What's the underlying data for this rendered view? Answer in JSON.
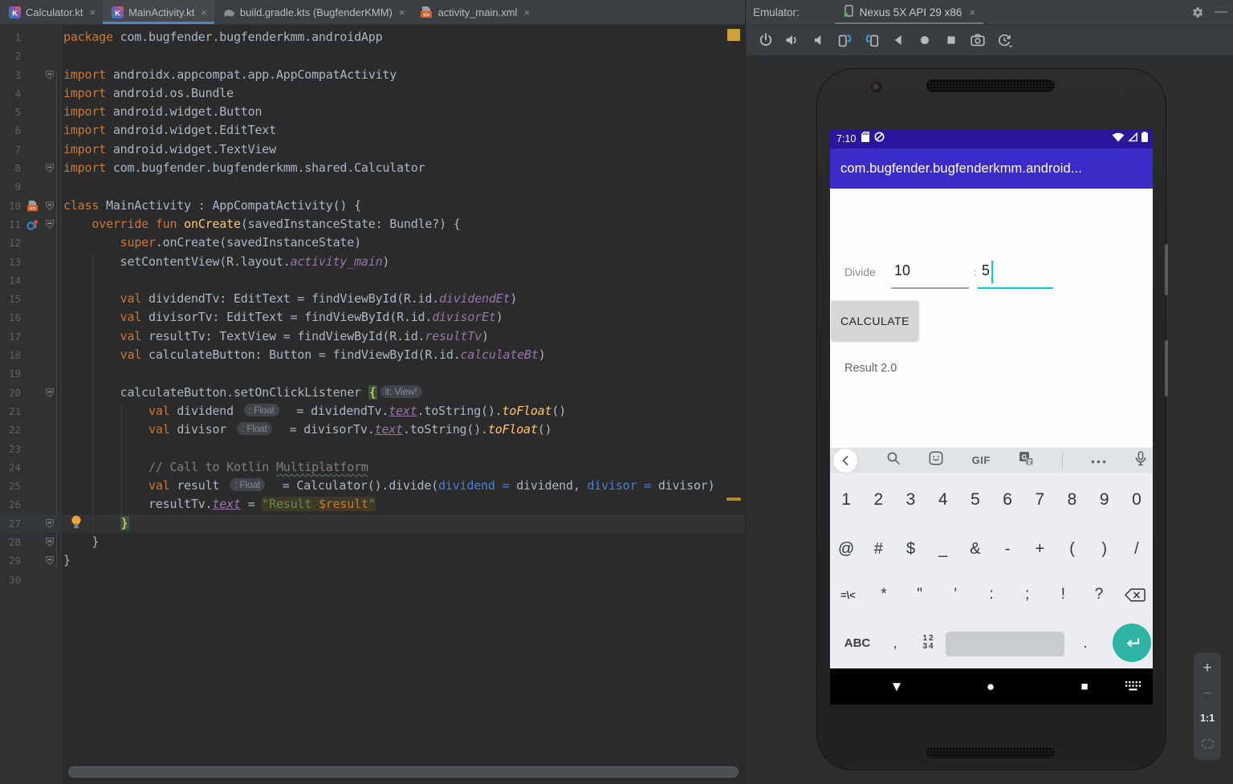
{
  "colors": {
    "accent_teal": "#00d3cb",
    "app_bar": "#3b2bc9",
    "status_bar": "#2a169c",
    "enter_key": "#2fb3a5",
    "tab_underline": "#4a88c7",
    "warning_stripe": "#d0a13a"
  },
  "ide": {
    "tabs": [
      {
        "label": "Calculator.kt",
        "icon": "kotlin",
        "active": false,
        "close": "×"
      },
      {
        "label": "MainActivity.kt",
        "icon": "kotlin",
        "active": true,
        "close": "×"
      },
      {
        "label": "build.gradle.kts (BugfenderKMM)",
        "icon": "gradle",
        "active": false,
        "close": "×"
      },
      {
        "label": "activity_main.xml",
        "icon": "xml",
        "active": false,
        "close": "×"
      }
    ],
    "editor": {
      "lines": [
        {
          "n": 1,
          "fold": "",
          "icon": "",
          "t": [
            [
              "k",
              "package"
            ],
            [
              "d",
              " com.bugfender.bugfenderkmm.androidApp"
            ]
          ]
        },
        {
          "n": 2,
          "fold": "",
          "icon": "",
          "t": []
        },
        {
          "n": 3,
          "fold": "start",
          "icon": "",
          "t": [
            [
              "k",
              "import"
            ],
            [
              "d",
              " androidx.appcompat.app.AppCompatActivity"
            ]
          ]
        },
        {
          "n": 4,
          "fold": "",
          "icon": "",
          "t": [
            [
              "k",
              "import"
            ],
            [
              "d",
              " android.os.Bundle"
            ]
          ]
        },
        {
          "n": 5,
          "fold": "",
          "icon": "",
          "t": [
            [
              "k",
              "import"
            ],
            [
              "d",
              " android.widget.Button"
            ]
          ]
        },
        {
          "n": 6,
          "fold": "",
          "icon": "",
          "t": [
            [
              "k",
              "import"
            ],
            [
              "d",
              " android.widget.EditText"
            ]
          ]
        },
        {
          "n": 7,
          "fold": "",
          "icon": "",
          "t": [
            [
              "k",
              "import"
            ],
            [
              "d",
              " android.widget.TextView"
            ]
          ]
        },
        {
          "n": 8,
          "fold": "end",
          "icon": "",
          "t": [
            [
              "k",
              "import"
            ],
            [
              "d",
              " com.bugfender.bugfenderkmm.shared.Calculator"
            ]
          ]
        },
        {
          "n": 9,
          "fold": "",
          "icon": "",
          "t": []
        },
        {
          "n": 10,
          "fold": "start",
          "icon": "layout",
          "t": [
            [
              "k",
              "class"
            ],
            [
              "d",
              " MainActivity : AppCompatActivity() {"
            ]
          ]
        },
        {
          "n": 11,
          "fold": "start",
          "icon": "override",
          "t": [
            [
              "d",
              "    "
            ],
            [
              "k",
              "override"
            ],
            [
              "d",
              " "
            ],
            [
              "k",
              "fun"
            ],
            [
              "d",
              " "
            ],
            [
              "f",
              "onCreate"
            ],
            [
              "d",
              "(savedInstanceState: Bundle?) {"
            ]
          ]
        },
        {
          "n": 12,
          "fold": "",
          "icon": "",
          "t": [
            [
              "d",
              "        "
            ],
            [
              "k",
              "super"
            ],
            [
              "d",
              ".onCreate(savedInstanceState)"
            ]
          ]
        },
        {
          "n": 13,
          "fold": "",
          "icon": "",
          "t": [
            [
              "d",
              "        setContentView(R.layout."
            ],
            [
              "i",
              "activity_main"
            ],
            [
              "d",
              ")"
            ]
          ]
        },
        {
          "n": 14,
          "fold": "",
          "icon": "",
          "t": []
        },
        {
          "n": 15,
          "fold": "",
          "icon": "",
          "t": [
            [
              "d",
              "        "
            ],
            [
              "k",
              "val"
            ],
            [
              "d",
              " dividendTv: EditText = findViewById(R.id."
            ],
            [
              "i",
              "dividendEt"
            ],
            [
              "d",
              ")"
            ]
          ]
        },
        {
          "n": 16,
          "fold": "",
          "icon": "",
          "t": [
            [
              "d",
              "        "
            ],
            [
              "k",
              "val"
            ],
            [
              "d",
              " divisorTv: EditText = findViewById(R.id."
            ],
            [
              "i",
              "divisorEt"
            ],
            [
              "d",
              ")"
            ]
          ]
        },
        {
          "n": 17,
          "fold": "",
          "icon": "",
          "t": [
            [
              "d",
              "        "
            ],
            [
              "k",
              "val"
            ],
            [
              "d",
              " resultTv: TextView = findViewById(R.id."
            ],
            [
              "i",
              "resultTv"
            ],
            [
              "d",
              ")"
            ]
          ]
        },
        {
          "n": 18,
          "fold": "",
          "icon": "",
          "t": [
            [
              "d",
              "        "
            ],
            [
              "k",
              "val"
            ],
            [
              "d",
              " calculateButton: Button = findViewById(R.id."
            ],
            [
              "i",
              "calculateBt"
            ],
            [
              "d",
              ")"
            ]
          ]
        },
        {
          "n": 19,
          "fold": "",
          "icon": "",
          "t": []
        },
        {
          "n": 20,
          "fold": "start",
          "icon": "",
          "t": [
            [
              "d",
              "        calculateButton.setOnClickListener "
            ],
            [
              "b",
              "{"
            ],
            [
              "h",
              "it: View!"
            ]
          ]
        },
        {
          "n": 21,
          "fold": "",
          "icon": "",
          "t": [
            [
              "d",
              "            "
            ],
            [
              "k",
              "val"
            ],
            [
              "d",
              " dividend "
            ],
            [
              "h",
              ": Float"
            ],
            [
              "d",
              "  = dividendTv."
            ],
            [
              "p",
              "text"
            ],
            [
              "d",
              ".toString()."
            ],
            [
              "x",
              "toFloat"
            ],
            [
              "d",
              "()"
            ]
          ]
        },
        {
          "n": 22,
          "fold": "",
          "icon": "",
          "t": [
            [
              "d",
              "            "
            ],
            [
              "k",
              "val"
            ],
            [
              "d",
              " divisor "
            ],
            [
              "h",
              ": Float"
            ],
            [
              "d",
              "  = divisorTv."
            ],
            [
              "p",
              "text"
            ],
            [
              "d",
              ".toString()."
            ],
            [
              "x",
              "toFloat"
            ],
            [
              "d",
              "()"
            ]
          ]
        },
        {
          "n": 23,
          "fold": "",
          "icon": "",
          "t": []
        },
        {
          "n": 24,
          "fold": "",
          "icon": "",
          "t": [
            [
              "d",
              "            "
            ],
            [
              "c",
              "// Call to Kotlin "
            ],
            [
              "w",
              "Multiplatform"
            ]
          ]
        },
        {
          "n": 25,
          "fold": "",
          "icon": "",
          "t": [
            [
              "d",
              "            "
            ],
            [
              "k",
              "val"
            ],
            [
              "d",
              " result "
            ],
            [
              "h",
              ": Float"
            ],
            [
              "d",
              "  = Calculator().divide("
            ],
            [
              "n",
              "dividend ="
            ],
            [
              "d",
              " dividend, "
            ],
            [
              "n",
              "divisor ="
            ],
            [
              "d",
              " divisor)"
            ]
          ]
        },
        {
          "n": 26,
          "fold": "",
          "icon": "",
          "t": [
            [
              "d",
              "            resultTv."
            ],
            [
              "p",
              "text"
            ],
            [
              "d",
              " = "
            ],
            [
              "s",
              "\"Result "
            ],
            [
              "t",
              "$result"
            ],
            [
              "s",
              "\""
            ]
          ]
        },
        {
          "n": 27,
          "fold": "end",
          "icon": "",
          "cur": true,
          "t": [
            [
              "d",
              "        "
            ],
            [
              "b",
              "}"
            ]
          ]
        },
        {
          "n": 28,
          "fold": "end",
          "icon": "",
          "t": [
            [
              "d",
              "    }"
            ]
          ]
        },
        {
          "n": 29,
          "fold": "end",
          "icon": "",
          "t": [
            [
              "d",
              "}"
            ]
          ]
        },
        {
          "n": 30,
          "fold": "",
          "icon": "",
          "t": []
        }
      ]
    }
  },
  "emulator": {
    "panel_label": "Emulator:",
    "device_tab": {
      "label": "Nexus 5X API 29 x86",
      "close": "×"
    },
    "window_controls": {
      "hide": "—"
    },
    "toolbar": [
      "power",
      "volume-up",
      "volume-down",
      "rotate-left",
      "rotate-right",
      "back",
      "home",
      "overview",
      "screenshot",
      "snapshots"
    ],
    "zoom": {
      "zoom_in": "+",
      "zoom_out": "−",
      "actual_size": "1:1"
    },
    "phone": {
      "status_bar": {
        "time": "7:10",
        "left_icons": [
          "sdcard",
          "data-saver"
        ],
        "right_icons": [
          "wifi",
          "cell-signal",
          "battery"
        ]
      },
      "app_bar": {
        "title": "com.bugfender.bugfenderkmm.android..."
      },
      "content": {
        "label": "Divide",
        "dividend_value": "10",
        "separator": ":",
        "divisor_value": "5",
        "button_label": "CALCULATE",
        "result_text": "Result 2.0"
      },
      "keyboard": {
        "strip": [
          "collapse",
          "search",
          "sticker",
          "gif",
          "translate",
          "divider",
          "more",
          "mic"
        ],
        "gif_label": "GIF",
        "sym_key_top": "12",
        "sym_key_bottom": "34",
        "abc_key": "ABC",
        "rows": [
          [
            "1",
            "2",
            "3",
            "4",
            "5",
            "6",
            "7",
            "8",
            "9",
            "0"
          ],
          [
            "@",
            "#",
            "$",
            "_",
            "&",
            "-",
            "+",
            "(",
            ")",
            "/"
          ],
          [
            "=\\<",
            "*",
            "\"",
            "'",
            ":",
            ";",
            "!",
            "?",
            "{backspace}"
          ],
          [
            "{abc}",
            ",",
            "{sym}",
            "{space}",
            ".",
            "{enter}"
          ]
        ]
      },
      "nav": {
        "back": "▼",
        "home": "●",
        "overview": "■"
      }
    }
  }
}
